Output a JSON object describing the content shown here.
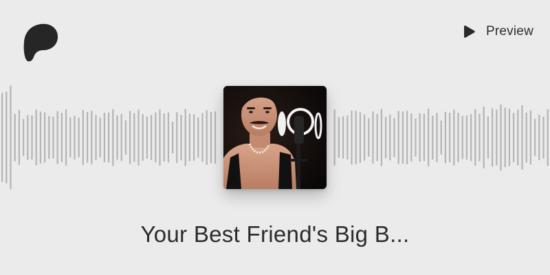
{
  "header": {
    "logo_icon": "patreon-logo-icon",
    "preview": {
      "icon": "play-icon",
      "label": "Preview"
    }
  },
  "player": {
    "cover_image": "podcast-cover-art",
    "title": "Your Best Friend's Big B..."
  },
  "colors": {
    "background": "#ebebeb",
    "waveform_bar": "#b4b4b4",
    "text": "#2b2b2b"
  }
}
